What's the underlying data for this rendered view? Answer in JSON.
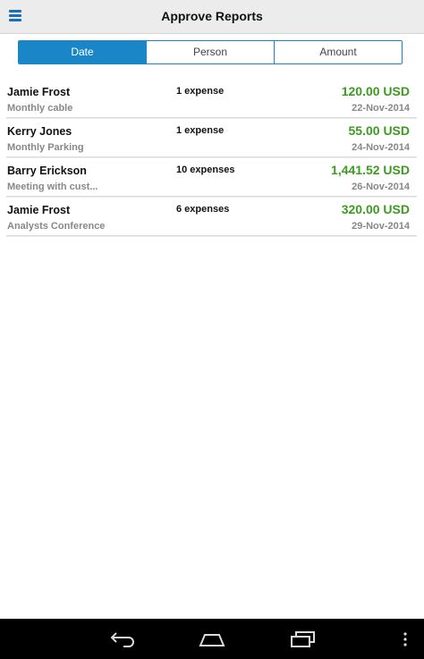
{
  "appbar": {
    "title": "Approve Reports",
    "menu_icon": "hamburger-menu-icon"
  },
  "tabs": [
    {
      "label": "Date",
      "active": true
    },
    {
      "label": "Person",
      "active": false
    },
    {
      "label": "Amount",
      "active": false
    }
  ],
  "reports": [
    {
      "name": "Jamie Frost",
      "count": "1 expense",
      "amount": "120.00 USD",
      "description": "Monthly cable",
      "date": "22-Nov-2014"
    },
    {
      "name": "Kerry Jones",
      "count": "1 expense",
      "amount": "55.00 USD",
      "description": "Monthly Parking",
      "date": "24-Nov-2014"
    },
    {
      "name": "Barry Erickson",
      "count": "10 expenses",
      "amount": "1,441.52 USD",
      "description": "Meeting with cust...",
      "date": "26-Nov-2014"
    },
    {
      "name": "Jamie Frost",
      "count": "6 expenses",
      "amount": "320.00 USD",
      "description": "Analysts Conference",
      "date": "29-Nov-2014"
    }
  ],
  "navbar": {
    "back_icon": "back-icon",
    "home_icon": "home-icon",
    "recents_icon": "recents-icon",
    "overflow_icon": "overflow-menu-icon"
  },
  "colors": {
    "accent": "#1a86c8",
    "amount": "#3a9b1e",
    "secondary_text": "#888888"
  }
}
